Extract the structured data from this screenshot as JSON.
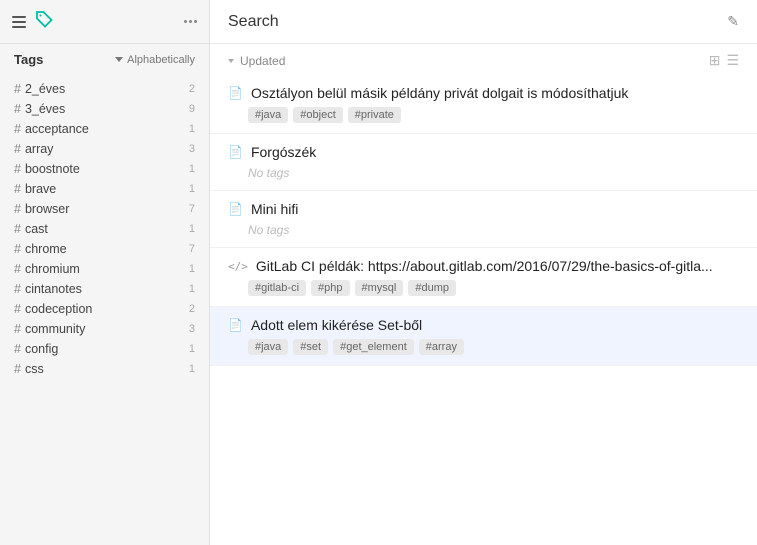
{
  "sidebar": {
    "section_title": "Tags",
    "sort_label": "Alphabetically",
    "tags": [
      {
        "name": "2_éves",
        "count": "2"
      },
      {
        "name": "3_éves",
        "count": "9"
      },
      {
        "name": "acceptance",
        "count": "1"
      },
      {
        "name": "array",
        "count": "3"
      },
      {
        "name": "boostnote",
        "count": "1"
      },
      {
        "name": "brave",
        "count": "1"
      },
      {
        "name": "browser",
        "count": "7"
      },
      {
        "name": "cast",
        "count": "1"
      },
      {
        "name": "chrome",
        "count": "7"
      },
      {
        "name": "chromium",
        "count": "1"
      },
      {
        "name": "cintanotes",
        "count": "1"
      },
      {
        "name": "codeception",
        "count": "2"
      },
      {
        "name": "community",
        "count": "3"
      },
      {
        "name": "config",
        "count": "1"
      },
      {
        "name": "css",
        "count": "1"
      }
    ]
  },
  "main": {
    "title": "Search",
    "group_label": "Updated",
    "edit_icon": "✎",
    "notes": [
      {
        "id": "note1",
        "type": "doc",
        "title": "Osztályon belül másik példány privát dolgait is módosíthatjuk",
        "tags": [
          "#java",
          "#object",
          "#private"
        ],
        "no_tags": false,
        "selected": false
      },
      {
        "id": "note2",
        "type": "doc",
        "title": "Forgószék",
        "tags": [],
        "no_tags": true,
        "selected": false
      },
      {
        "id": "note3",
        "type": "doc",
        "title": "Mini hifi",
        "tags": [],
        "no_tags": true,
        "selected": false
      },
      {
        "id": "note4",
        "type": "code",
        "title": "GitLab CI példák: https://about.gitlab.com/2016/07/29/the-basics-of-gitla...",
        "tags": [
          "#gitlab-ci",
          "#php",
          "#mysql",
          "#dump"
        ],
        "no_tags": false,
        "selected": false
      },
      {
        "id": "note5",
        "type": "doc",
        "title": "Adott elem kikérése Set-ből",
        "tags": [
          "#java",
          "#set",
          "#get_element",
          "#array"
        ],
        "no_tags": false,
        "selected": true
      }
    ]
  }
}
